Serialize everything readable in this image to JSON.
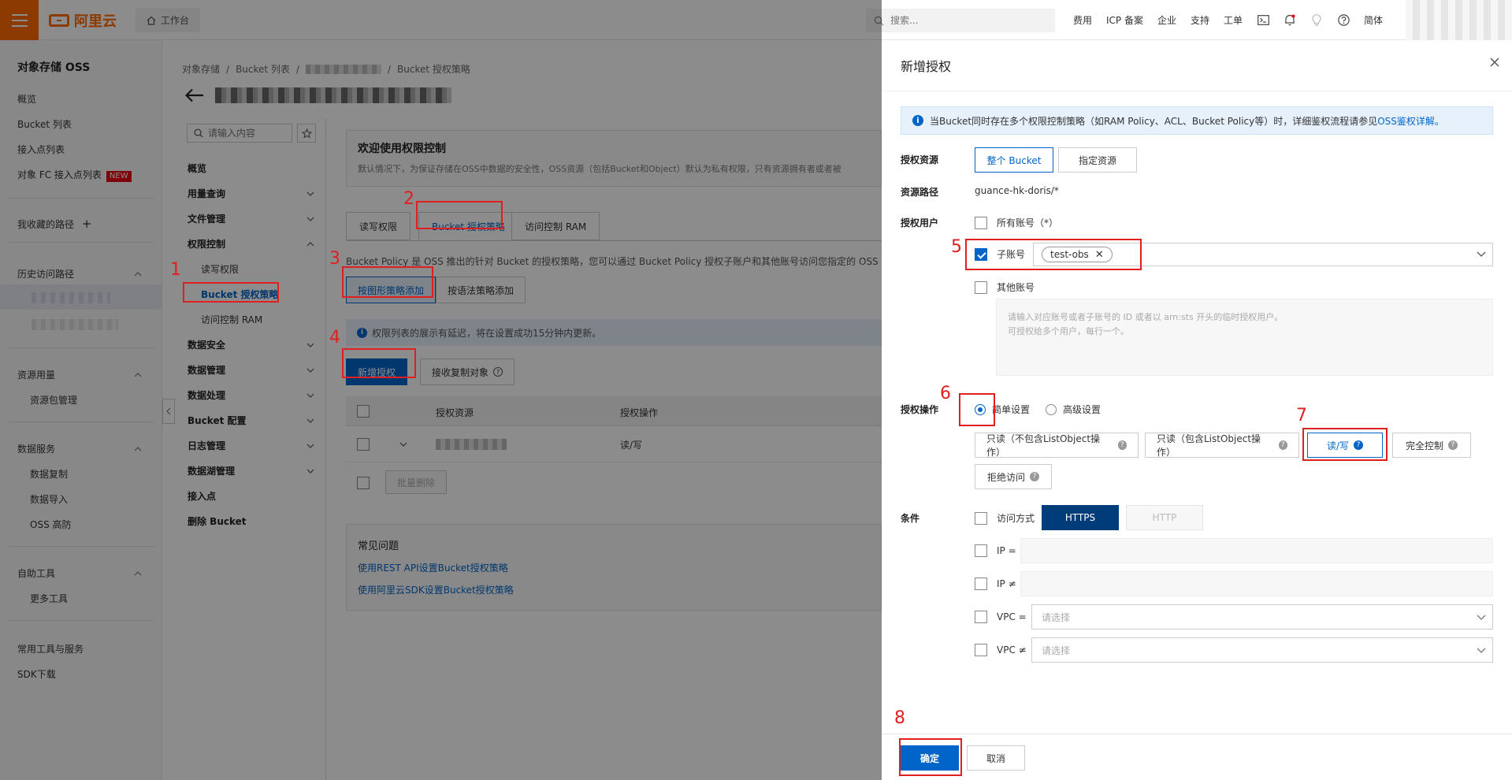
{
  "topbar": {
    "logo": "阿里云",
    "workbench": "工作台",
    "search_placeholder": "搜索...",
    "nav": [
      "费用",
      "ICP 备案",
      "企业",
      "支持",
      "工单"
    ],
    "lang": "简体"
  },
  "sidebar": {
    "title": "对象存储 OSS",
    "items": [
      "概览",
      "Bucket 列表",
      "接入点列表",
      "对象 FC 接入点列表"
    ],
    "new_badge": "NEW",
    "favorites": "我收藏的路径",
    "history": "历史访问路径",
    "resource": "资源用量",
    "resource_sub": "资源包管理",
    "data_service": "数据服务",
    "data_service_sub": [
      "数据复制",
      "数据导入",
      "OSS 高防"
    ],
    "self_tools": "自助工具",
    "self_tools_sub": "更多工具",
    "bottom": [
      "常用工具与服务",
      "SDK下载"
    ]
  },
  "main": {
    "breadcrumb": [
      "对象存储",
      "Bucket 列表",
      "Bucket 授权策略"
    ],
    "search_placeholder": "请输入内容",
    "nav": [
      "概览",
      "用量查询",
      "文件管理",
      "权限控制",
      "读写权限",
      "Bucket 授权策略",
      "访问控制 RAM",
      "数据安全",
      "数据管理",
      "数据处理",
      "Bucket 配置",
      "日志管理",
      "数据湖管理",
      "接入点",
      "删除 Bucket"
    ],
    "welcome_title": "欢迎使用权限控制",
    "welcome_desc": "默认情况下，为保证存储在OSS中数据的安全性，OSS资源（包括Bucket和Object）默认为私有权限，只有资源拥有者或者被",
    "tabs": [
      "读写权限",
      "Bucket 授权策略",
      "访问控制 RAM"
    ],
    "policy_desc": "Bucket Policy 是 OSS 推出的针对 Bucket 的授权策略，您可以通过 Bucket Policy 授权子账户和其他账号访问您指定的 OSS 资",
    "btn_graphic": "按图形策略添加",
    "btn_syntax": "按语法策略添加",
    "notice": "权限列表的展示有延迟，将在设置成功15分钟内更新。",
    "btn_add": "新增授权",
    "btn_replica": "接收复制对象",
    "col_resource": "授权资源",
    "col_action": "授权操作",
    "row_action": "读/写",
    "btn_batch_delete": "批量删除",
    "faq_title": "常见问题",
    "faq_links": [
      "使用REST API设置Bucket授权策略",
      "使用阿里云SDK设置Bucket授权策略"
    ]
  },
  "drawer": {
    "title": "新增授权",
    "info_text": "当Bucket同时存在多个权限控制策略（如RAM Policy、ACL、Bucket Policy等）时，详细鉴权流程请参见",
    "info_link": "OSS鉴权详解。",
    "label_resource": "授权资源",
    "resource_opts": [
      "整个 Bucket",
      "指定资源"
    ],
    "label_path": "资源路径",
    "path_value": "guance-hk-doris/*",
    "label_user": "授权用户",
    "user_all": "所有账号（*）",
    "user_sub": "子账号",
    "sub_tag": "test-obs",
    "user_other": "其他账号",
    "other_placeholder_1": "请输入对应账号或者子账号的 ID 或者以 arn:sts 开头的临时授权用户。",
    "other_placeholder_2": "可授权给多个用户，每行一个。",
    "label_action": "授权操作",
    "action_modes": [
      "简单设置",
      "高级设置"
    ],
    "action_opts": [
      "只读（不包含ListObject操作）",
      "只读（包含ListObject操作）",
      "读/写",
      "完全控制",
      "拒绝访问"
    ],
    "label_cond": "条件",
    "cond_access": "访问方式",
    "cond_https": "HTTPS",
    "cond_http": "HTTP",
    "cond_ip_eq": "IP =",
    "cond_ip_ne": "IP ≠",
    "cond_vpc_eq": "VPC =",
    "cond_vpc_ne": "VPC ≠",
    "select_placeholder": "请选择",
    "ok": "确定",
    "cancel": "取消"
  },
  "annotations": [
    "1",
    "2",
    "3",
    "4",
    "5",
    "6",
    "7",
    "8"
  ],
  "colors": {
    "brand": "#ff6a00",
    "primary": "#0064c8",
    "highlight": "#e02020"
  }
}
